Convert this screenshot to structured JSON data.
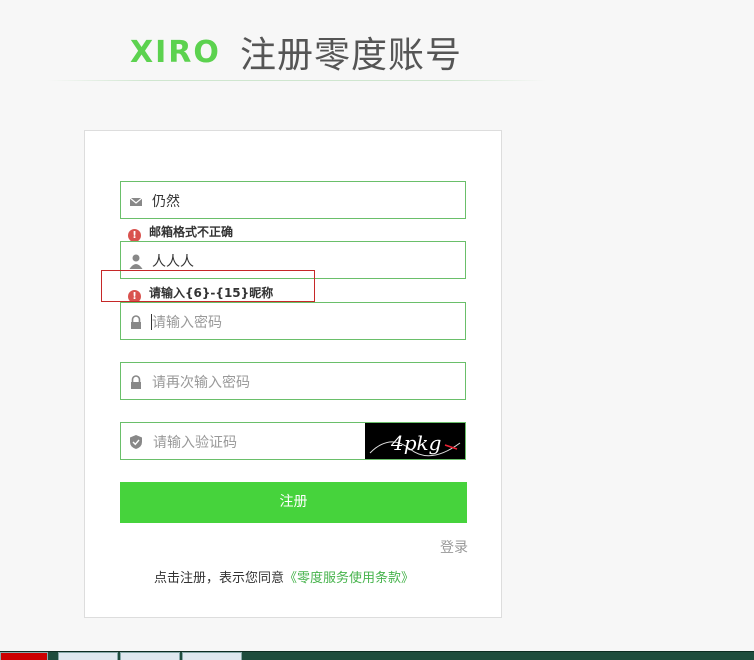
{
  "header": {
    "logo_text": "XIRO",
    "title": "注册零度账号"
  },
  "form": {
    "email": {
      "value": "仍然",
      "icon": "mail-icon"
    },
    "email_error": "邮箱格式不正确",
    "nickname": {
      "value": "人人人",
      "icon": "user-icon"
    },
    "nickname_error": "请输入{6}-{15}昵称",
    "password": {
      "placeholder": "请输入密码",
      "icon": "lock-icon"
    },
    "password_confirm": {
      "placeholder": "请再次输入密码",
      "icon": "lock-icon"
    },
    "captcha": {
      "placeholder": "请输入验证码",
      "icon": "shield-icon",
      "image_text": "4pkg"
    },
    "submit_label": "注册",
    "login_link": "登录",
    "terms_prefix": "点击注册，表示您同意",
    "terms_link": "《零度服务使用条款》"
  },
  "colors": {
    "accent": "#46d33c",
    "border": "#6abf6a",
    "error": "#d9534f",
    "highlight": "#c62828"
  }
}
